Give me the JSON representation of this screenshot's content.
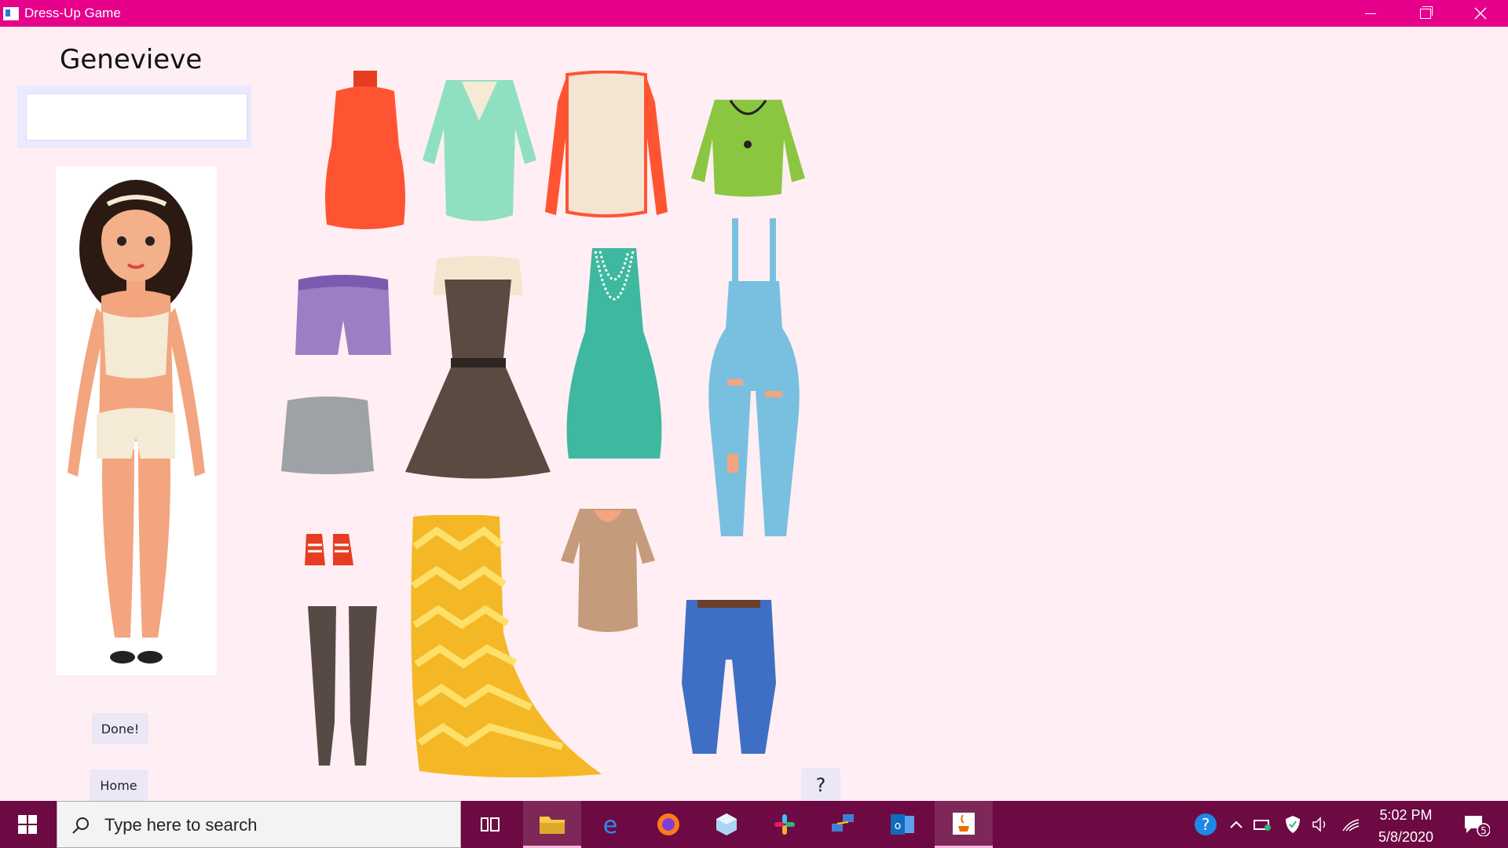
{
  "window": {
    "title": "Dress-Up Game"
  },
  "character": {
    "name": "Genevieve",
    "name_input_value": ""
  },
  "buttons": {
    "done": "Done!",
    "home": "Home",
    "help": "?"
  },
  "wardrobe": [
    "red-sleeveless-top",
    "mint-vneck-top",
    "cream-red-sleeve-top",
    "green-crop-top-necklace",
    "purple-shorts",
    "brown-cream-dress",
    "teal-dress-pearls",
    "blue-ripped-overalls",
    "gray-skirt",
    "red-sneakers",
    "dark-knee-boots",
    "yellow-chevron-maxi-skirt",
    "tan-tshirt",
    "blue-jeans"
  ],
  "taskbar": {
    "search_placeholder": "Type here to search",
    "time": "5:02 PM",
    "date": "5/8/2020",
    "notification_count": "5",
    "apps": [
      "task-view",
      "file-explorer",
      "edge",
      "firefox",
      "3d-viewer",
      "slack",
      "network-app",
      "outlook",
      "java"
    ]
  },
  "colors": {
    "titlebar": "#e6008a",
    "background": "#ffeef3",
    "taskbar": "#6d0a43"
  }
}
